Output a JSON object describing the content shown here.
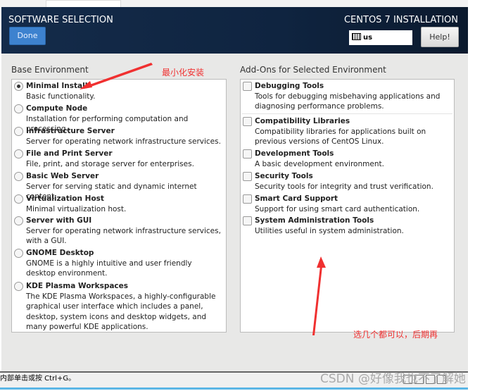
{
  "header": {
    "title": "SOFTWARE SELECTION",
    "done_label": "Done",
    "product": "CENTOS 7 INSTALLATION",
    "keyboard_layout": "us",
    "help_label": "Help!"
  },
  "base_environment": {
    "label": "Base Environment",
    "selected": "Minimal Install",
    "items": [
      {
        "title": "Minimal Install",
        "desc": "Basic functionality."
      },
      {
        "title": "Compute Node",
        "desc": "Installation for performing computation and processing."
      },
      {
        "title": "Infrastructure Server",
        "desc": "Server for operating network infrastructure services."
      },
      {
        "title": "File and Print Server",
        "desc": "File, print, and storage server for enterprises."
      },
      {
        "title": "Basic Web Server",
        "desc": "Server for serving static and dynamic internet content."
      },
      {
        "title": "Virtualization Host",
        "desc": "Minimal virtualization host."
      },
      {
        "title": "Server with GUI",
        "desc": "Server for operating network infrastructure services, with a GUI."
      },
      {
        "title": "GNOME Desktop",
        "desc": "GNOME is a highly intuitive and user friendly desktop environment."
      },
      {
        "title": "KDE Plasma Workspaces",
        "desc": "The KDE Plasma Workspaces, a highly-configurable graphical user interface which includes a panel, desktop, system icons and desktop widgets, and many powerful KDE applications."
      }
    ]
  },
  "addons": {
    "label": "Add-Ons for Selected Environment",
    "items": [
      {
        "title": "Debugging Tools",
        "desc": "Tools for debugging misbehaving applications and diagnosing performance problems.",
        "checked": false
      },
      {
        "title": "Compatibility Libraries",
        "desc": "Compatibility libraries for applications built on previous versions of CentOS Linux.",
        "checked": false
      },
      {
        "title": "Development Tools",
        "desc": "A basic development environment.",
        "checked": false
      },
      {
        "title": "Security Tools",
        "desc": "Security tools for integrity and trust verification.",
        "checked": false
      },
      {
        "title": "Smart Card Support",
        "desc": "Support for using smart card authentication.",
        "checked": false
      },
      {
        "title": "System Administration Tools",
        "desc": "Utilities useful in system administration.",
        "checked": false
      }
    ]
  },
  "annotations": {
    "minimal": "最小化安装",
    "addons_note": "选几个都可以，后期再"
  },
  "statusbar": {
    "text": "内部单击或按 Ctrl+G。"
  },
  "watermark": "CSDN @好像我也不了解她",
  "colors": {
    "header": "#142b4a",
    "done": "#3d82cf",
    "annotation": "#f03030"
  }
}
